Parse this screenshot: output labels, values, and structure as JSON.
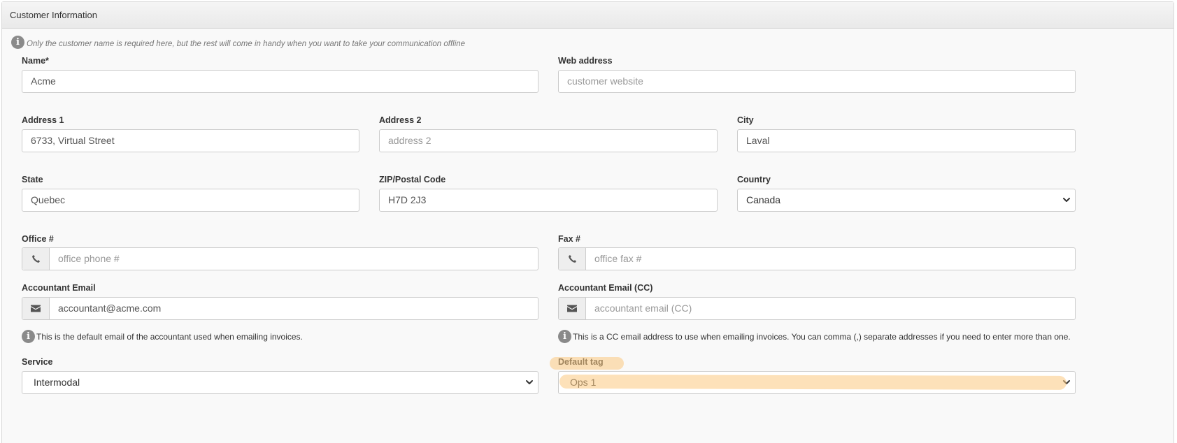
{
  "panel": {
    "title": "Customer Information"
  },
  "intro_note": "Only the customer name is required here, but the rest will come in handy when you want to take your communication offline",
  "fields": {
    "name": {
      "label": "Name*",
      "value": "Acme"
    },
    "web_address": {
      "label": "Web address",
      "placeholder": "customer website"
    },
    "address1": {
      "label": "Address 1",
      "value": "6733, Virtual Street"
    },
    "address2": {
      "label": "Address 2",
      "placeholder": "address 2"
    },
    "city": {
      "label": "City",
      "value": "Laval"
    },
    "state": {
      "label": "State",
      "value": "Quebec"
    },
    "zip": {
      "label": "ZIP/Postal Code",
      "value": "H7D 2J3"
    },
    "country": {
      "label": "Country",
      "selected": "Canada"
    },
    "office_phone": {
      "label": "Office #",
      "placeholder": "office phone #",
      "icon": "phone-icon"
    },
    "fax": {
      "label": "Fax #",
      "placeholder": "office fax #",
      "icon": "phone-icon"
    },
    "accountant_email": {
      "label": "Accountant Email",
      "value": "accountant@acme.com",
      "icon": "envelope-icon",
      "help": "This is the default email of the accountant used when emailing invoices."
    },
    "accountant_email_cc": {
      "label": "Accountant Email (CC)",
      "placeholder": "accountant email (CC)",
      "icon": "envelope-icon",
      "help": "This is a CC email address to use when emailing invoices. You can comma (,) separate addresses if you need to enter more than one."
    },
    "service": {
      "label": "Service",
      "selected": "Intermodal"
    },
    "default_tag": {
      "label": "Default tag",
      "selected": "Ops 1"
    }
  },
  "colors": {
    "highlight": "#fcc880",
    "info_icon": "#8a8a8a",
    "addon_bg": "#eeeeee"
  }
}
